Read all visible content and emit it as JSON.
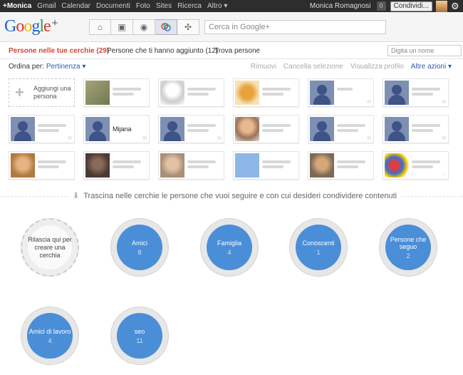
{
  "topbar": {
    "nav": [
      "+Monica",
      "Gmail",
      "Calendar",
      "Documenti",
      "Foto",
      "Sites",
      "Ricerca",
      "Altro ▾"
    ],
    "user_name": "Monica Romagnosi",
    "notification_count": "0",
    "share_label": "Condividi..."
  },
  "header": {
    "search_placeholder": "Cerca in Google+"
  },
  "tabs": {
    "circles": "Persone nelle tue cerchie (29)",
    "added_you": "Persone che ti hanno aggiunto (12)",
    "find": "Trova persone",
    "name_placeholder": "Digita un nome"
  },
  "sort": {
    "label": "Ordina per:",
    "value": "Pertinenza ▾",
    "remove": "Rimuovi",
    "clear_selection": "Cancella selezione",
    "view_profile": "Visualizza profilo",
    "more_actions": "Altre azioni ▾"
  },
  "add_person": "Aggiungi una persona",
  "person_name": "Mijana",
  "hint": "Trascina nelle cerchie le persone che vuoi seguire e con cui desideri condividere contenuti",
  "drop_zone": "Rilascia qui per creare una cerchia",
  "circles": [
    {
      "name": "Amici",
      "count": "8"
    },
    {
      "name": "Famiglia",
      "count": "4"
    },
    {
      "name": "Conoscenti",
      "count": "1"
    },
    {
      "name": "Persone che seguo",
      "count": "2"
    },
    {
      "name": "Amici di lavoro",
      "count": "4"
    },
    {
      "name": "seo",
      "count": "11"
    }
  ],
  "colors": {
    "accent_red": "#d14836",
    "circle_blue": "#4a8ed8",
    "link_blue": "#2a5db0"
  }
}
